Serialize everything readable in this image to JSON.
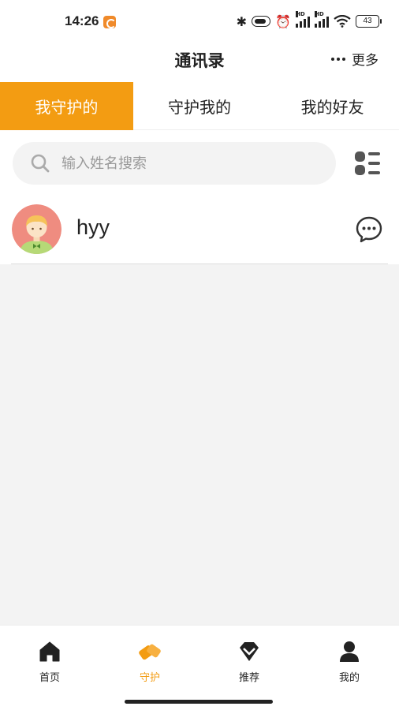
{
  "status_bar": {
    "time": "14:26",
    "signal_label": "HD",
    "battery": "43"
  },
  "header": {
    "title": "通讯录",
    "more_label": "更多"
  },
  "tabs": [
    {
      "label": "我守护的",
      "active": true
    },
    {
      "label": "守护我的",
      "active": false
    },
    {
      "label": "我的好友",
      "active": false
    }
  ],
  "search": {
    "placeholder": "输入姓名搜索",
    "value": ""
  },
  "contacts": [
    {
      "name": "hyy"
    }
  ],
  "bottom_nav": [
    {
      "label": "首页",
      "icon": "home-icon",
      "active": false
    },
    {
      "label": "守护",
      "icon": "guard-icon",
      "active": true
    },
    {
      "label": "推荐",
      "icon": "diamond-icon",
      "active": false
    },
    {
      "label": "我的",
      "icon": "person-icon",
      "active": false
    }
  ],
  "colors": {
    "accent": "#f39c12",
    "background": "#f3f3f3",
    "text": "#222222"
  }
}
